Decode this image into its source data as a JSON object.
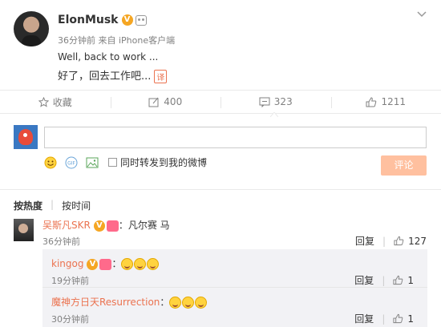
{
  "post": {
    "author": "ElonMusk",
    "time": "36分钟前",
    "source": "来自 iPhone客户端",
    "text_en": "Well, back to work ...",
    "text_zh": "好了，回去工作吧...",
    "translate_label": "译"
  },
  "actions": {
    "favorite_label": "收藏",
    "repost_count": "400",
    "comment_count": "323",
    "like_count": "1211"
  },
  "composer": {
    "sync_label": "同时转发到我的微博",
    "submit_label": "评论",
    "gif_label": "GIF"
  },
  "sort": {
    "hot": "按热度",
    "time": "按时间"
  },
  "comments": [
    {
      "user": "吴斯凡SKR",
      "text": "：凡尔赛 马",
      "time": "36分钟前",
      "reply_label": "回复",
      "likes": "127"
    }
  ],
  "replies": [
    {
      "user": "kingog",
      "text": "：",
      "time": "19分钟前",
      "reply_label": "回复",
      "likes": "1"
    },
    {
      "user": "魔神方日天Resurrection",
      "text": "：",
      "time": "30分钟前",
      "reply_label": "回复",
      "likes": "1"
    }
  ],
  "colors": {
    "accent": "#eb7350",
    "submit_bg": "#ffc09f",
    "vip": "#f5a623"
  }
}
